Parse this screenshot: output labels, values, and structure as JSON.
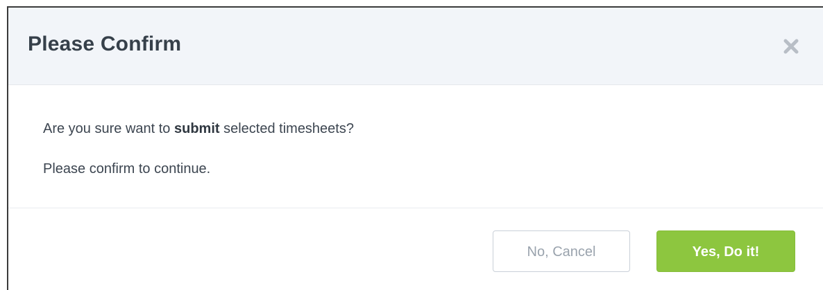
{
  "dialog": {
    "title": "Please Confirm",
    "close_icon": "close-icon",
    "message": {
      "prefix": "Are you sure want to ",
      "emphasis": "submit",
      "suffix": " selected timesheets?"
    },
    "secondary_message": "Please confirm to continue."
  },
  "footer": {
    "cancel_label": "No, Cancel",
    "confirm_label": "Yes, Do it!"
  },
  "colors": {
    "header_background": "#f2f5f9",
    "confirm_button": "#8dc63f",
    "cancel_button_text": "#9aa3ad",
    "title_text": "#36404a"
  }
}
